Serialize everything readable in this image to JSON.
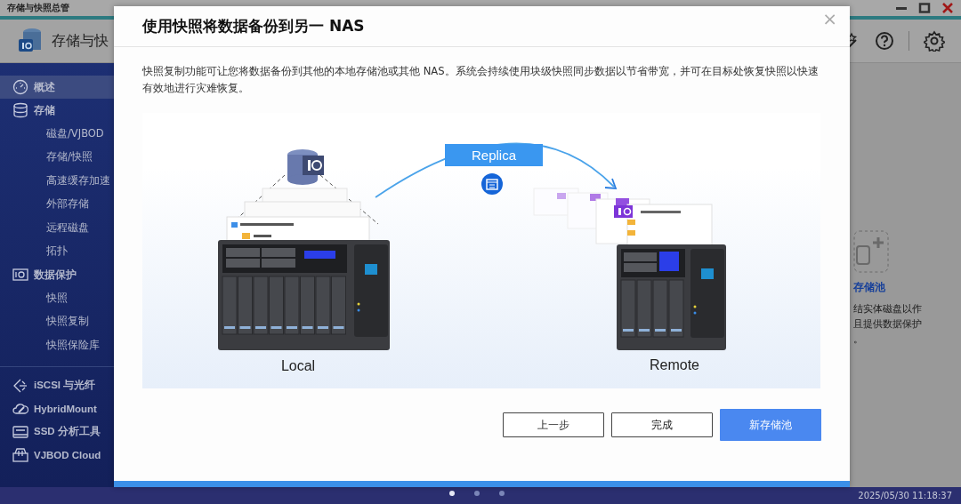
{
  "app": {
    "title": "存储与快照总管",
    "header_title": "存储与快"
  },
  "sidebar": {
    "sections": [
      {
        "items": [
          {
            "label": "概述",
            "kind": "main",
            "selected": true
          },
          {
            "label": "存储",
            "kind": "main",
            "selected": false
          },
          {
            "label": "磁盘/VJBOD",
            "kind": "sub",
            "selected": false
          },
          {
            "label": "存储/快照",
            "kind": "sub",
            "selected": false
          },
          {
            "label": "高速缓存加速",
            "kind": "sub",
            "selected": false
          },
          {
            "label": "外部存储",
            "kind": "sub",
            "selected": false
          },
          {
            "label": "远程磁盘",
            "kind": "sub",
            "selected": false
          },
          {
            "label": "拓扑",
            "kind": "sub",
            "selected": false
          },
          {
            "label": "数据保护",
            "kind": "main",
            "selected": false
          },
          {
            "label": "快照",
            "kind": "sub",
            "selected": false
          },
          {
            "label": "快照复制",
            "kind": "sub",
            "selected": false
          },
          {
            "label": "快照保险库",
            "kind": "sub",
            "selected": false
          }
        ]
      },
      {
        "items": [
          {
            "label": "iSCSI 与光纤",
            "kind": "main",
            "selected": false
          },
          {
            "label": "HybridMount",
            "kind": "main",
            "selected": false
          },
          {
            "label": "SSD 分析工具",
            "kind": "main",
            "selected": false
          },
          {
            "label": "VJBOD Cloud",
            "kind": "main",
            "selected": false
          }
        ]
      }
    ]
  },
  "content": {
    "link": "存储池",
    "lines": [
      "结实体磁盘以作",
      "且提供数据保护",
      "。"
    ]
  },
  "dialog": {
    "title": "使用快照将数据备份到另一 NAS",
    "close": "×",
    "description": "快照复制功能可让您将数据备份到其他的本地存储池或其他 NAS。系统会持续使用块级快照同步数据以节省带宽，并可在目标处恢复快照以快速有效地进行灾难恢复。",
    "illustration": {
      "replica": "Replica",
      "local": "Local",
      "remote": "Remote"
    },
    "buttons": [
      {
        "label": "上一步",
        "kind": "secondary"
      },
      {
        "label": "完成",
        "kind": "secondary"
      },
      {
        "label": "新存储池",
        "kind": "primary"
      }
    ]
  },
  "taskbar": {
    "pages": [
      {
        "selected": true
      },
      {
        "selected": false
      },
      {
        "selected": false
      }
    ],
    "clock": "2025/05/30 11:18:37"
  }
}
